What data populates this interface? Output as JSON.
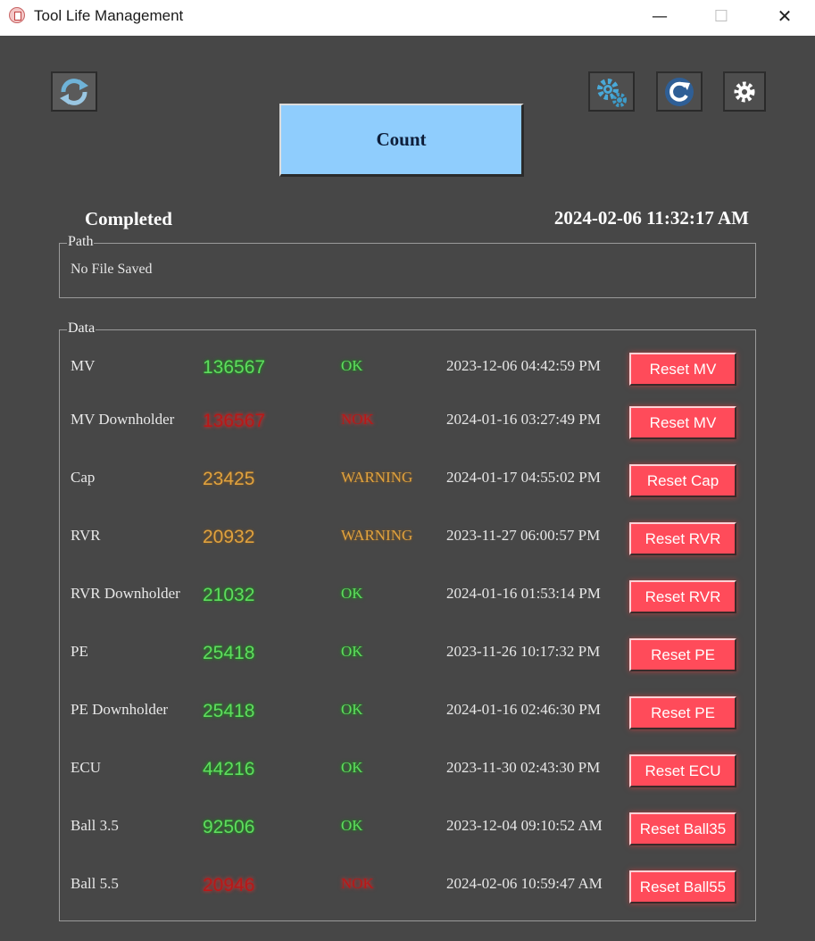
{
  "window": {
    "title": "Tool Life Management",
    "min_glyph": "—",
    "max_glyph": "☐",
    "close_glyph": "✕"
  },
  "toolbar": {
    "sync_icon": "sync-arrows-icon",
    "gears_icon": "gears-icon",
    "refresh_icon": "refresh-icon",
    "settings_icon": "gear-icon"
  },
  "count_button": {
    "label": "Count"
  },
  "status": {
    "text": "Completed",
    "datetime": "2024-02-06 11:32:17 AM"
  },
  "path_group": {
    "legend": "Path",
    "value": "No File Saved"
  },
  "data_group": {
    "legend": "Data",
    "rows": [
      {
        "name": "MV",
        "count": "136567",
        "state": "OK",
        "date": "2023-12-06 04:42:59 PM",
        "reset_label": "Reset MV",
        "status_color": "good"
      },
      {
        "name": "MV Downholder",
        "count": "136567",
        "state": "NOK",
        "date": "2024-01-16 03:27:49 PM",
        "reset_label": "Reset MV",
        "status_color": "bad"
      },
      {
        "name": "Cap",
        "count": "23425",
        "state": "WARNING",
        "date": "2024-01-17 04:55:02 PM",
        "reset_label": "Reset Cap",
        "status_color": "warn"
      },
      {
        "name": "RVR",
        "count": "20932",
        "state": "WARNING",
        "date": "2023-11-27 06:00:57 PM",
        "reset_label": "Reset RVR",
        "status_color": "warn"
      },
      {
        "name": "RVR Downholder",
        "count": "21032",
        "state": "OK",
        "date": "2024-01-16 01:53:14 PM",
        "reset_label": "Reset RVR",
        "status_color": "good"
      },
      {
        "name": "PE",
        "count": "25418",
        "state": "OK",
        "date": "2023-11-26 10:17:32 PM",
        "reset_label": "Reset PE",
        "status_color": "good"
      },
      {
        "name": "PE Downholder",
        "count": "25418",
        "state": "OK",
        "date": "2024-01-16 02:46:30 PM",
        "reset_label": "Reset PE",
        "status_color": "good"
      },
      {
        "name": "ECU",
        "count": "44216",
        "state": "OK",
        "date": "2023-11-30 02:43:30 PM",
        "reset_label": "Reset ECU",
        "status_color": "good"
      },
      {
        "name": "Ball 3.5",
        "count": "92506",
        "state": "OK",
        "date": "2023-12-04 09:10:52 AM",
        "reset_label": "Reset Ball35",
        "status_color": "good"
      },
      {
        "name": "Ball 5.5",
        "count": "20946",
        "state": "NOK",
        "date": "2024-02-06 10:59:47 AM",
        "reset_label": "Reset Ball55",
        "status_color": "bad"
      }
    ]
  },
  "colors": {
    "background": "#474747",
    "count_button": "#8fcdfd",
    "reset_button": "#ff4b5a",
    "ok_green": "#5fdc5f",
    "warning_orange": "#e0a23e",
    "nok_red": "#b81818"
  }
}
